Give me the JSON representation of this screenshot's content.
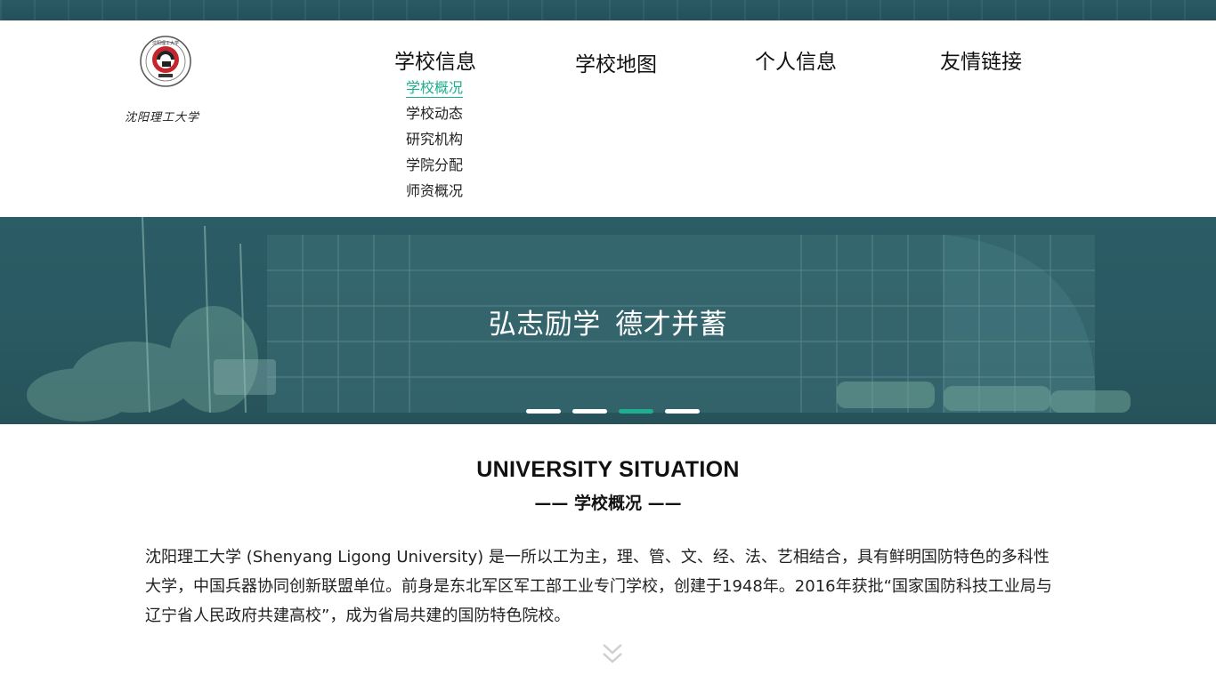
{
  "header": {
    "logo_text": "沈阳理工大学",
    "logo_year": "1948",
    "nav": [
      {
        "label": "学校信息"
      },
      {
        "label": "学校地图"
      },
      {
        "label": "个人信息"
      },
      {
        "label": "友情链接"
      }
    ],
    "submenu": [
      {
        "label": "学校概况",
        "active": true
      },
      {
        "label": "学校动态"
      },
      {
        "label": "研究机构"
      },
      {
        "label": "学院分配"
      },
      {
        "label": "师资概况"
      }
    ]
  },
  "banner": {
    "title": "弘志励学  德才并蓄",
    "slides": 4,
    "active_slide": 3
  },
  "section": {
    "title_en": "UNIVERSITY SITUATION",
    "title_cn": "—— 学校概况 ——",
    "intro": "沈阳理工大学 (Shenyang Ligong University) 是一所以工为主，理、管、文、经、法、艺相结合，具有鲜明国防特色的多科性大学，中国兵器协同创新联盟单位。前身是东北军区军工部工业专门学校，创建于1948年。2016年获批“国家国防科技工业局与辽宁省人民政府共建高校”，成为省局共建的国防特色院校。"
  },
  "colors": {
    "accent": "#1fae8f",
    "banner_bg": "#2a5962",
    "logo_red": "#c8242b"
  },
  "icons": {
    "scroll_down": "double-chevron-down-icon"
  }
}
